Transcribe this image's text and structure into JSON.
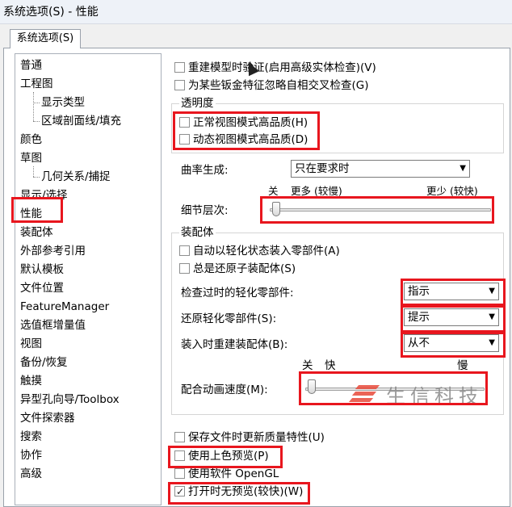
{
  "window": {
    "title": "系统选项(S) - 性能"
  },
  "tab": {
    "label": "系统选项(S)"
  },
  "tree": {
    "items": [
      {
        "label": "普通",
        "sub": false
      },
      {
        "label": "工程图",
        "sub": false
      },
      {
        "label": "显示类型",
        "sub": true
      },
      {
        "label": "区域剖面线/填充",
        "sub": true
      },
      {
        "label": "颜色",
        "sub": false
      },
      {
        "label": "草图",
        "sub": false
      },
      {
        "label": "几何关系/捕捉",
        "sub": true
      },
      {
        "label": "显示/选择",
        "sub": false
      },
      {
        "label": "性能",
        "sub": false,
        "selected": true
      },
      {
        "label": "装配体",
        "sub": false
      },
      {
        "label": "外部参考引用",
        "sub": false
      },
      {
        "label": "默认模板",
        "sub": false
      },
      {
        "label": "文件位置",
        "sub": false
      },
      {
        "label": "FeatureManager",
        "sub": false
      },
      {
        "label": "选值框增量值",
        "sub": false
      },
      {
        "label": "视图",
        "sub": false
      },
      {
        "label": "备份/恢复",
        "sub": false
      },
      {
        "label": "触摸",
        "sub": false
      },
      {
        "label": "异型孔向导/Toolbox",
        "sub": false
      },
      {
        "label": "文件探索器",
        "sub": false
      },
      {
        "label": "搜索",
        "sub": false
      },
      {
        "label": "协作",
        "sub": false
      },
      {
        "label": "高级",
        "sub": false
      }
    ]
  },
  "options": {
    "rebuild_verify": {
      "label": "重建模型时验证(启用高级实体检查)(V)",
      "checked": false
    },
    "ignore_self_intersect": {
      "label": "为某些钣金特征忽略自相交叉检查(G)",
      "checked": false
    },
    "transparency": {
      "title": "透明度",
      "normal_hq": {
        "label": "正常视图模式高品质(H)",
        "checked": false
      },
      "dynamic_hq": {
        "label": "动态视图模式高品质(D)",
        "checked": false
      }
    },
    "curvature": {
      "label": "曲率生成:",
      "value": "只在要求时"
    },
    "detail_level": {
      "label": "细节层次:",
      "off": "关",
      "more": "更多 (较慢)",
      "less": "更少 (较快)",
      "position": 0
    },
    "assemblies": {
      "title": "装配体",
      "auto_lightweight": {
        "label": "自动以轻化状态装入零部件(A)",
        "checked": false
      },
      "always_resolve": {
        "label": "总是还原子装配体(S)",
        "checked": false
      },
      "check_outofdate": {
        "label": "检查过时的轻化零部件:",
        "value": "指示"
      },
      "resolve_lightweight": {
        "label": "还原轻化零部件(S):",
        "value": "提示"
      },
      "rebuild_on_load": {
        "label": "装入时重建装配体(B):",
        "value": "从不"
      },
      "mate_animation": {
        "label": "配合动画速度(M):",
        "off": "关",
        "fast": "快",
        "slow": "慢",
        "position": 0
      }
    },
    "save_mass_props": {
      "label": "保存文件时更新质量特性(U)",
      "checked": false
    },
    "shaded_preview": {
      "label": "使用上色预览(P)",
      "checked": false
    },
    "software_opengl": {
      "label": "使用软件 OpenGL",
      "checked": false
    },
    "no_preview_open": {
      "label": "打开时无预览(较快)(W)",
      "checked": true
    }
  },
  "watermark": {
    "text": "生信科技"
  },
  "colors": {
    "highlight": "#e8161e",
    "accent": "#e84a3a"
  }
}
